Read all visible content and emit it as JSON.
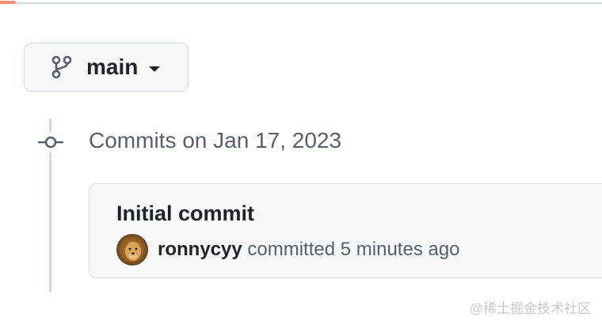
{
  "branch": {
    "name": "main",
    "icon": "git-branch-icon",
    "caret_icon": "triangle-down-icon"
  },
  "timeline": {
    "heading": "Commits on Jan 17, 2023",
    "icon": "git-commit-icon"
  },
  "commits": [
    {
      "title": "Initial commit",
      "author": "ronnycyy",
      "action": "committed",
      "time": "5 minutes ago",
      "avatar": "lion-avatar"
    }
  ],
  "watermark": "@稀土掘金技术社区",
  "colors": {
    "border": "#d0d7de",
    "card_bg": "#f6f8fa",
    "muted_text": "#57606a",
    "primary_text": "#1f2328",
    "tab_accent": "#fd8c73"
  }
}
